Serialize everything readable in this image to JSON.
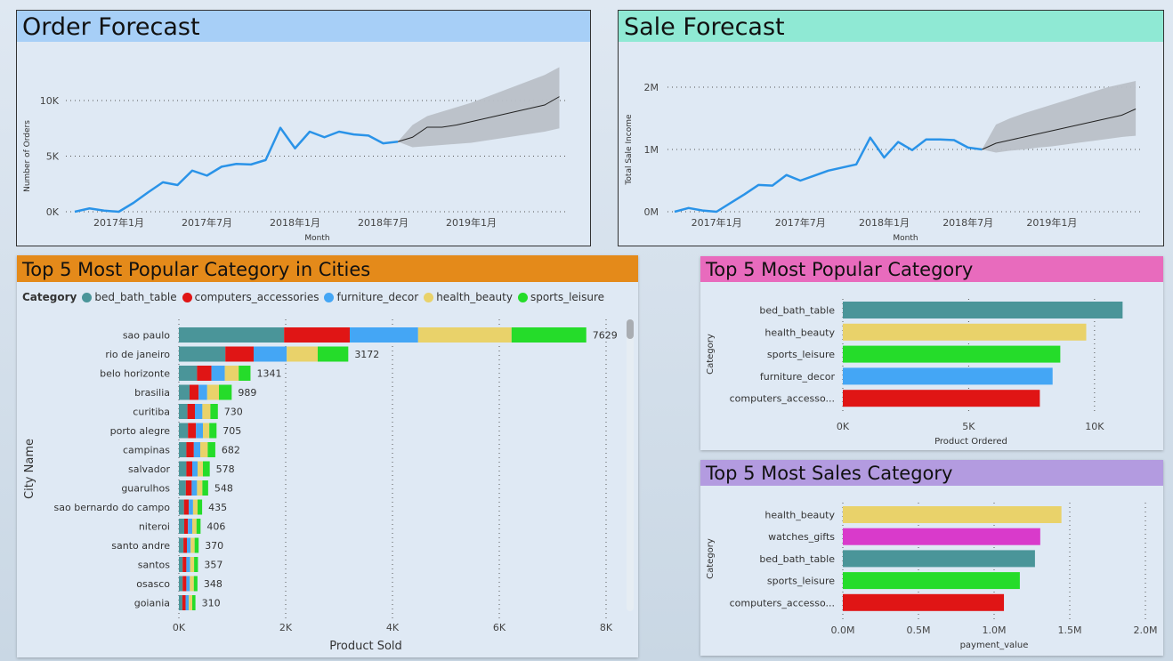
{
  "order_forecast": {
    "title": "Order Forecast",
    "ylabel": "Number of Orders",
    "xlabel": "Month",
    "y_ticks": [
      "0K",
      "5K",
      "10K"
    ],
    "x_ticks": [
      "2017年1月",
      "2017年7月",
      "2018年1月",
      "2018年7月",
      "2019年1月"
    ],
    "header_color": "#a7cff7"
  },
  "sale_forecast": {
    "title": "Sale Forecast",
    "ylabel": "Total Sale Income",
    "xlabel": "Month",
    "y_ticks": [
      "0M",
      "1M",
      "2M"
    ],
    "x_ticks": [
      "2017年1月",
      "2017年7月",
      "2018年1月",
      "2018年7月",
      "2019年1月"
    ],
    "header_color": "#8fe9d4"
  },
  "cities": {
    "title": "Top 5 Most Popular Category in Cities",
    "legend_title": "Category",
    "ylabel": "City Name",
    "xlabel": "Product Sold",
    "x_ticks": [
      "0K",
      "2K",
      "4K",
      "6K",
      "8K"
    ],
    "header_color": "#e48a1a"
  },
  "popular": {
    "title": "Top 5 Most Popular Category",
    "ylabel": "Category",
    "xlabel": "Product Ordered",
    "x_ticks": [
      "0K",
      "5K",
      "10K"
    ],
    "header_color": "#e86bbd"
  },
  "sales": {
    "title": "Top 5 Most Sales Category",
    "ylabel": "Category",
    "xlabel": "payment_value",
    "x_ticks": [
      "0.0M",
      "0.5M",
      "1.0M",
      "1.5M",
      "2.0M"
    ],
    "header_color": "#b39be0"
  },
  "colors": {
    "bed_bath_table": "#4a9599",
    "computers_accessories": "#e01515",
    "furniture_decor": "#44a6f5",
    "health_beauty": "#e9d26a",
    "sports_leisure": "#25dc2a",
    "watches_gifts": "#d93acb",
    "line": "#2a93e8",
    "forecast_band": "#b9c0c7"
  },
  "chart_data": [
    {
      "type": "line",
      "id": "order_forecast",
      "x": [
        "2016-10",
        "2016-11",
        "2016-12",
        "2017-01",
        "2017-02",
        "2017-03",
        "2017-04",
        "2017-05",
        "2017-06",
        "2017-07",
        "2017-08",
        "2017-09",
        "2017-10",
        "2017-11",
        "2017-12",
        "2018-01",
        "2018-02",
        "2018-03",
        "2018-04",
        "2018-05",
        "2018-06",
        "2018-07",
        "2018-08"
      ],
      "values": [
        0,
        300,
        100,
        0,
        800,
        1750,
        2650,
        2400,
        3700,
        3250,
        4050,
        4300,
        4250,
        4650,
        7550,
        5700,
        7200,
        6700,
        7200,
        6950,
        6850,
        6150,
        6300
      ],
      "forecast": {
        "x": [
          "2018-08",
          "2018-09",
          "2018-10",
          "2018-11",
          "2018-12",
          "2019-01",
          "2019-02",
          "2019-03",
          "2019-04",
          "2019-05",
          "2019-06",
          "2019-07"
        ],
        "values": [
          6300,
          6700,
          7600,
          7600,
          7800,
          8100,
          8400,
          8700,
          9000,
          9300,
          9600,
          10350
        ],
        "upper": [
          6300,
          7800,
          8600,
          9000,
          9400,
          9800,
          10300,
          10800,
          11300,
          11800,
          12300,
          13000
        ],
        "lower": [
          6300,
          5800,
          5900,
          6000,
          6100,
          6200,
          6400,
          6600,
          6800,
          7000,
          7200,
          7500
        ]
      },
      "ylim": [
        0,
        13000
      ],
      "xlabel": "Month",
      "ylabel": "Number of Orders"
    },
    {
      "type": "line",
      "id": "sale_forecast",
      "x": [
        "2016-10",
        "2016-11",
        "2016-12",
        "2017-01",
        "2017-02",
        "2017-03",
        "2017-04",
        "2017-05",
        "2017-06",
        "2017-07",
        "2017-08",
        "2017-09",
        "2017-10",
        "2017-11",
        "2017-12",
        "2018-01",
        "2018-02",
        "2018-03",
        "2018-04",
        "2018-05",
        "2018-06",
        "2018-07",
        "2018-08"
      ],
      "values": [
        0,
        60000,
        20000,
        0,
        140000,
        280000,
        430000,
        420000,
        590000,
        500000,
        580000,
        660000,
        710000,
        760000,
        1190000,
        870000,
        1120000,
        990000,
        1160000,
        1160000,
        1150000,
        1030000,
        1000000
      ],
      "forecast": {
        "x": [
          "2018-08",
          "2018-09",
          "2018-10",
          "2018-11",
          "2018-12",
          "2019-01",
          "2019-02",
          "2019-03",
          "2019-04",
          "2019-05",
          "2019-06",
          "2019-07"
        ],
        "values": [
          1000000,
          1100000,
          1150000,
          1200000,
          1250000,
          1300000,
          1350000,
          1400000,
          1450000,
          1500000,
          1550000,
          1650000
        ],
        "upper": [
          1000000,
          1400000,
          1500000,
          1580000,
          1650000,
          1720000,
          1790000,
          1860000,
          1930000,
          2000000,
          2050000,
          2100000
        ],
        "lower": [
          1000000,
          950000,
          980000,
          1000000,
          1030000,
          1050000,
          1080000,
          1110000,
          1140000,
          1170000,
          1200000,
          1220000
        ]
      },
      "ylim": [
        0,
        2100000
      ],
      "xlabel": "Month",
      "ylabel": "Total Sale Income"
    },
    {
      "type": "bar",
      "orientation": "horizontal",
      "stacked": true,
      "id": "cities",
      "categories": [
        "sao paulo",
        "rio de janeiro",
        "belo horizonte",
        "brasilia",
        "curitiba",
        "porto alegre",
        "campinas",
        "salvador",
        "guarulhos",
        "sao bernardo do campo",
        "niteroi",
        "santo andre",
        "santos",
        "osasco",
        "goiania"
      ],
      "totals": [
        7629,
        3172,
        1341,
        989,
        730,
        705,
        682,
        578,
        548,
        435,
        406,
        370,
        357,
        348,
        310
      ],
      "series": [
        {
          "name": "bed_bath_table",
          "values": [
            1970,
            870,
            340,
            200,
            160,
            170,
            140,
            140,
            130,
            95,
            100,
            85,
            70,
            70,
            65
          ]
        },
        {
          "name": "computers_accessories",
          "values": [
            1230,
            530,
            270,
            170,
            140,
            150,
            140,
            110,
            110,
            90,
            70,
            65,
            70,
            70,
            60
          ]
        },
        {
          "name": "furniture_decor",
          "values": [
            1280,
            620,
            250,
            160,
            140,
            130,
            120,
            100,
            100,
            80,
            80,
            70,
            70,
            65,
            60
          ]
        },
        {
          "name": "health_beauty",
          "values": [
            1750,
            580,
            260,
            220,
            150,
            120,
            140,
            100,
            100,
            85,
            80,
            75,
            75,
            75,
            65
          ]
        },
        {
          "name": "sports_leisure",
          "values": [
            1399,
            572,
            221,
            239,
            140,
            135,
            142,
            128,
            108,
            85,
            76,
            75,
            72,
            68,
            60
          ]
        }
      ],
      "xlim": [
        0,
        8000
      ],
      "xlabel": "Product Sold",
      "ylabel": "City Name"
    },
    {
      "type": "bar",
      "orientation": "horizontal",
      "id": "popular",
      "categories": [
        "bed_bath_table",
        "health_beauty",
        "sports_leisure",
        "furniture_decor",
        "computers_accesso..."
      ],
      "values": [
        11115,
        9670,
        8640,
        8334,
        7827
      ],
      "colors": [
        "#4a9599",
        "#e9d26a",
        "#25dc2a",
        "#44a6f5",
        "#e01515"
      ],
      "xlim": [
        0,
        12000
      ],
      "xlabel": "Product Ordered",
      "ylabel": "Category"
    },
    {
      "type": "bar",
      "orientation": "horizontal",
      "id": "sales",
      "categories": [
        "health_beauty",
        "watches_gifts",
        "bed_bath_table",
        "sports_leisure",
        "computers_accesso..."
      ],
      "values": [
        1445000,
        1305000,
        1270000,
        1170000,
        1065000
      ],
      "colors": [
        "#e9d26a",
        "#d93acb",
        "#4a9599",
        "#25dc2a",
        "#e01515"
      ],
      "xlim": [
        0,
        2000000
      ],
      "xlabel": "payment_value",
      "ylabel": "Category"
    }
  ]
}
